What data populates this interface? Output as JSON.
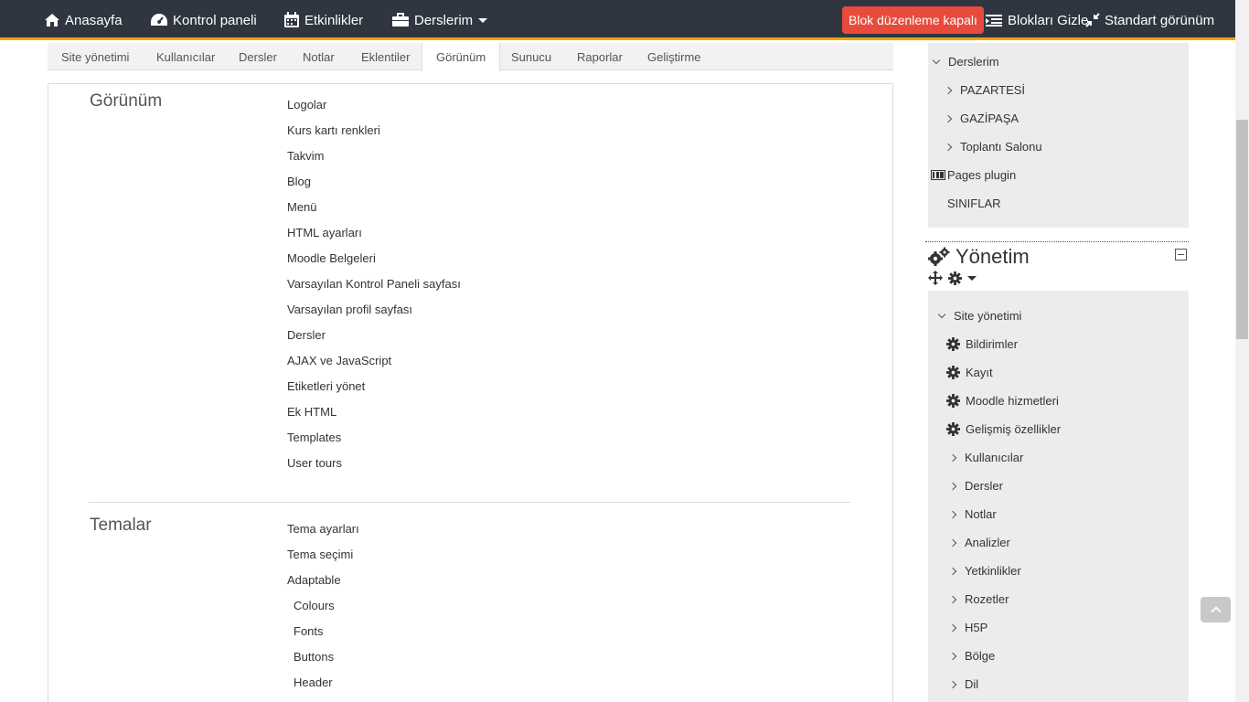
{
  "navbar": {
    "home": "Anasayfa",
    "dashboard": "Kontrol paneli",
    "events": "Etkinlikler",
    "courses": "Derslerim",
    "edit_button": "Blok düzenleme kapalı",
    "hide_blocks": "Blokları Gizle",
    "standard_view": "Standart görünüm"
  },
  "tabs": [
    "Site yönetimi",
    "Kullanıcılar",
    "Dersler",
    "Notlar",
    "Eklentiler",
    "Görünüm",
    "Sunucu",
    "Raporlar",
    "Geliştirme"
  ],
  "active_tab": "Görünüm",
  "appearance": {
    "title": "Görünüm",
    "links": [
      "Logolar",
      "Kurs kartı renkleri",
      "Takvim",
      "Blog",
      "Menü",
      "HTML ayarları",
      "Moodle Belgeleri",
      "Varsayılan Kontrol Paneli sayfası",
      "Varsayılan profil sayfası",
      "Dersler",
      "AJAX ve JavaScript",
      "Etiketleri yönet",
      "Ek HTML",
      "Templates",
      "User tours"
    ]
  },
  "themes": {
    "title": "Temalar",
    "links": [
      "Tema ayarları",
      "Tema seçimi",
      "Adaptable"
    ],
    "sublinks": [
      "Colours",
      "Fonts",
      "Buttons",
      "Header"
    ]
  },
  "nav_block": {
    "my_courses": "Derslerim",
    "courses": [
      "PAZARTESİ",
      "GAZİPAŞA",
      "Toplantı Salonu"
    ],
    "pages_plugin": "Pages plugin",
    "classes": "SINIFLAR"
  },
  "admin_block": {
    "title": "Yönetim",
    "site_admin": "Site yönetimi",
    "gear_items": [
      "Bildirimler",
      "Kayıt",
      "Moodle hizmetleri",
      "Gelişmiş özellikler"
    ],
    "items": [
      "Kullanıcılar",
      "Dersler",
      "Notlar",
      "Analizler",
      "Yetkinlikler",
      "Rozetler",
      "H5P",
      "Bölge",
      "Dil"
    ]
  }
}
